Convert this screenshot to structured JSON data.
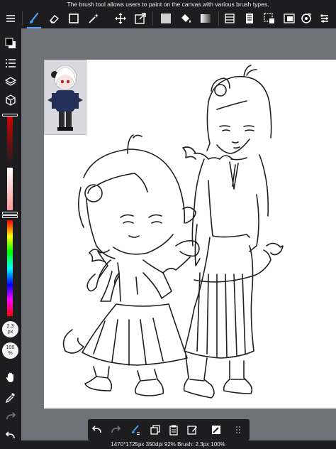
{
  "tooltip": "The brush tool allows users to paint on the canvas with various brush types.",
  "status": "1470*1725px 350dpi 92% Brush: 2.3px 100%",
  "brush": {
    "size_value": "2.3",
    "size_unit": "px",
    "opacity_value": "100",
    "opacity_unit": "%"
  },
  "colors": {
    "accent": "#4aa3ff",
    "toolbar_bg": "#1d1d1f",
    "workspace_bg": "#707279",
    "canvas_bg": "#ffffff"
  },
  "toolbar": {
    "tools": [
      {
        "name": "menu-icon"
      },
      {
        "name": "brush-icon",
        "active": true
      },
      {
        "name": "eraser-icon"
      },
      {
        "name": "selection-rect-icon"
      },
      {
        "name": "magic-wand-icon"
      },
      {
        "name": "move-icon"
      },
      {
        "name": "transform-icon"
      },
      {
        "name": "fill-color-icon"
      },
      {
        "name": "bucket-icon"
      },
      {
        "name": "gradient-icon"
      },
      {
        "name": "layer-panel-icon"
      },
      {
        "name": "material-icon"
      },
      {
        "name": "select-layer-icon"
      },
      {
        "name": "navigator-icon"
      },
      {
        "name": "rotate-icon"
      },
      {
        "name": "more-icon"
      }
    ]
  },
  "sidebar": {
    "tools": [
      "color-swatch-icon",
      "brush-list-icon",
      "layers-icon",
      "materials-icon",
      "hand-icon",
      "eyedropper-icon",
      "redo-icon",
      "undo-icon"
    ]
  },
  "bottombar": {
    "tools": [
      "undo-icon",
      "redo-icon",
      "brush-settings-icon",
      "copy-icon",
      "paste-icon",
      "edit-icon",
      "ruler-icon",
      "grid-icon"
    ]
  }
}
